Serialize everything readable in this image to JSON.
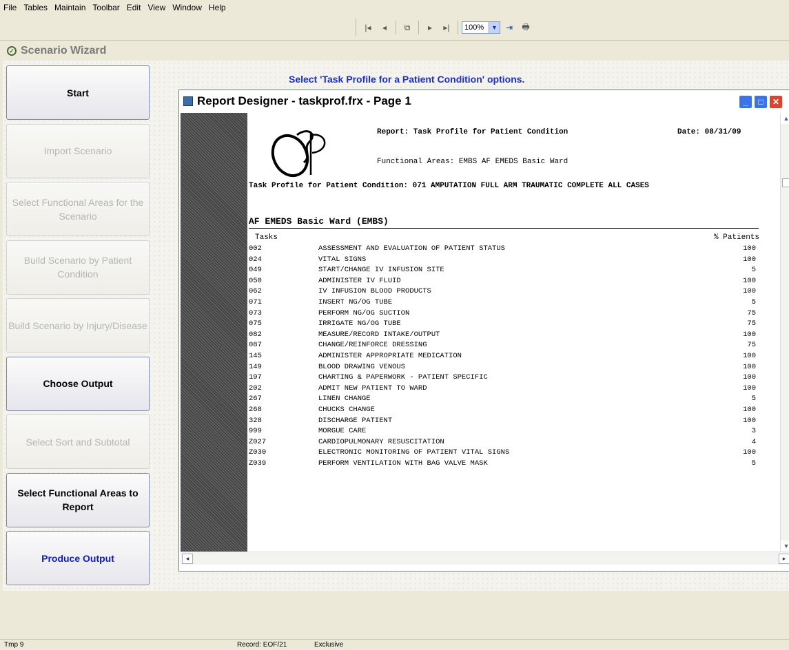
{
  "menu": [
    "File",
    "Tables",
    "Maintain",
    "Toolbar",
    "Edit",
    "View",
    "Window",
    "Help"
  ],
  "toolbar": {
    "zoom": "100%"
  },
  "wizard": {
    "title": "Scenario Wizard",
    "instruction": "Select 'Task Profile for a Patient Condition' options.",
    "buttons": [
      {
        "label": "Start",
        "state": "active"
      },
      {
        "label": "Import Scenario",
        "state": "disabled"
      },
      {
        "label": "Select Functional Areas for the Scenario",
        "state": "disabled"
      },
      {
        "label": "Build Scenario by Patient Condition",
        "state": "disabled"
      },
      {
        "label": "Build Scenario by Injury/Disease",
        "state": "disabled"
      },
      {
        "label": "Choose Output",
        "state": "active"
      },
      {
        "label": "Select Sort and Subtotal",
        "state": "disabled"
      },
      {
        "label": "Select Functional Areas to Report",
        "state": "active"
      },
      {
        "label": "Produce Output",
        "state": "active-blue"
      }
    ]
  },
  "report_window": {
    "title": "Report Designer - taskprof.frx - Page 1",
    "logo_text": "eSP",
    "report_label": "Report:  Task Profile for Patient Condition",
    "date_label": "Date: 08/31/09",
    "functional_areas": "Functional Areas: EMBS AF EMEDS Basic Ward",
    "condition": "Task Profile for Patient Condition: 071 AMPUTATION  FULL ARM  TRAUMATIC  COMPLETE  ALL CASES",
    "section": "AF EMEDS Basic Ward (EMBS)",
    "col_tasks": "Tasks",
    "col_patients": "% Patients",
    "rows": [
      {
        "code": "002",
        "task": "ASSESSMENT AND EVALUATION OF PATIENT STATUS",
        "pct": "100"
      },
      {
        "code": "024",
        "task": "VITAL SIGNS",
        "pct": "100"
      },
      {
        "code": "049",
        "task": "START/CHANGE IV INFUSION SITE",
        "pct": "5"
      },
      {
        "code": "050",
        "task": "ADMINISTER IV FLUID",
        "pct": "100"
      },
      {
        "code": "062",
        "task": "IV INFUSION BLOOD PRODUCTS",
        "pct": "100"
      },
      {
        "code": "071",
        "task": "INSERT NG/OG TUBE",
        "pct": "5"
      },
      {
        "code": "073",
        "task": "PERFORM NG/OG SUCTION",
        "pct": "75"
      },
      {
        "code": "075",
        "task": "IRRIGATE NG/OG TUBE",
        "pct": "75"
      },
      {
        "code": "082",
        "task": "MEASURE/RECORD INTAKE/OUTPUT",
        "pct": "100"
      },
      {
        "code": "087",
        "task": "CHANGE/REINFORCE DRESSING",
        "pct": "75"
      },
      {
        "code": "145",
        "task": "ADMINISTER APPROPRIATE MEDICATION",
        "pct": "100"
      },
      {
        "code": "149",
        "task": "BLOOD DRAWING VENOUS",
        "pct": "100"
      },
      {
        "code": "197",
        "task": "CHARTING & PAPERWORK - PATIENT SPECIFIC",
        "pct": "100"
      },
      {
        "code": "202",
        "task": "ADMIT NEW PATIENT TO WARD",
        "pct": "100"
      },
      {
        "code": "267",
        "task": "LINEN CHANGE",
        "pct": "5"
      },
      {
        "code": "268",
        "task": "CHUCKS CHANGE",
        "pct": "100"
      },
      {
        "code": "328",
        "task": "DISCHARGE PATIENT",
        "pct": "100"
      },
      {
        "code": "999",
        "task": "MORGUE CARE",
        "pct": "3"
      },
      {
        "code": "Z027",
        "task": "CARDIOPULMONARY RESUSCITATION",
        "pct": "4"
      },
      {
        "code": "Z030",
        "task": "ELECTRONIC MONITORING OF PATIENT VITAL SIGNS",
        "pct": "100"
      },
      {
        "code": "Z039",
        "task": "PERFORM VENTILATION WITH BAG VALVE MASK",
        "pct": "5"
      }
    ]
  },
  "status": {
    "left": "Tmp 9",
    "record": "Record: EOF/21",
    "mode": "Exclusive"
  }
}
